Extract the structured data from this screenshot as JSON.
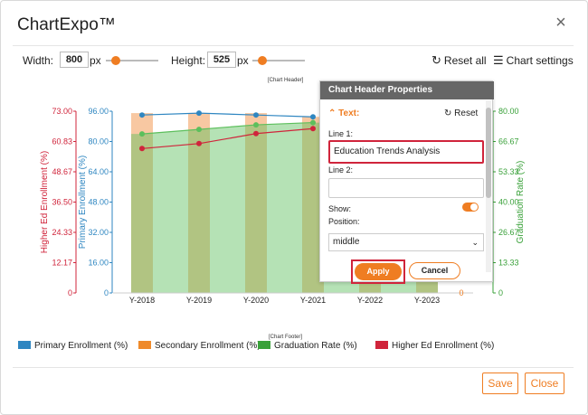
{
  "app": {
    "title": "ChartExpo™"
  },
  "toolbar": {
    "width_label": "Width:",
    "width_value": "800",
    "width_unit": "px",
    "height_label": "Height:",
    "height_value": "525",
    "height_unit": "px",
    "reset_all_label": "Reset all",
    "chart_settings_label": "Chart settings"
  },
  "chart_tags": {
    "header": "[Chart Header]",
    "footer": "[Chart Footer]"
  },
  "chart_data": {
    "type": "bar",
    "categories": [
      "Y-2018",
      "Y-2019",
      "Y-2020",
      "Y-2021",
      "Y-2022",
      "Y-2023"
    ],
    "axes": {
      "higher_ed": {
        "label": "Higher Ed Enrollment (%)",
        "ticks": [
          "73.00",
          "60.83",
          "48.67",
          "36.50",
          "24.33",
          "12.17",
          "0"
        ],
        "range": [
          0,
          73
        ],
        "color": "#d0243b"
      },
      "primary": {
        "label": "Primary Enrollment (%)",
        "ticks": [
          "96.00",
          "80.00",
          "64.00",
          "48.00",
          "32.00",
          "16.00",
          "0"
        ],
        "range": [
          0,
          96
        ],
        "color": "#2e86c1"
      },
      "graduation": {
        "label": "Graduation Rate (%)",
        "ticks": [
          "80.00",
          "66.67",
          "53.33",
          "40.00",
          "26.67",
          "13.33",
          "0"
        ],
        "range": [
          0,
          80
        ],
        "color": "#3aa13a"
      }
    },
    "series": [
      {
        "name": "Primary Enrollment (%)",
        "color": "#2e86c1",
        "values": [
          94,
          95,
          94,
          93,
          null,
          null
        ]
      },
      {
        "name": "Secondary Enrollment (%)",
        "color": "#f5b07a",
        "values": [
          95,
          95,
          95,
          93,
          92,
          92
        ]
      },
      {
        "name": "Graduation Rate (%)",
        "color": "#5cbf5c",
        "values": [
          70,
          72,
          74,
          75,
          null,
          null
        ]
      },
      {
        "name": "Higher Ed Enrollment (%)",
        "color": "#d0243b",
        "values": [
          58,
          60,
          64,
          66,
          null,
          null
        ]
      }
    ]
  },
  "legend": [
    {
      "label": "Primary Enrollment (%)",
      "color": "#2e86c1"
    },
    {
      "label": "Secondary Enrollment (%)",
      "color": "#ef8a2b"
    },
    {
      "label": "Graduation Rate (%)",
      "color": "#3aa13a"
    },
    {
      "label": "Higher Ed Enrollment (%)",
      "color": "#d0243b"
    }
  ],
  "panel": {
    "title": "Chart Header Properties",
    "section": "Text:",
    "reset_label": "Reset",
    "line1_label": "Line 1:",
    "line1_value": "Education Trends Analysis",
    "line2_label": "Line 2:",
    "line2_value": "",
    "show_label": "Show:",
    "position_label": "Position:",
    "position_value": "middle",
    "apply_label": "Apply",
    "cancel_label": "Cancel"
  },
  "footer": {
    "save_label": "Save",
    "close_label": "Close"
  }
}
